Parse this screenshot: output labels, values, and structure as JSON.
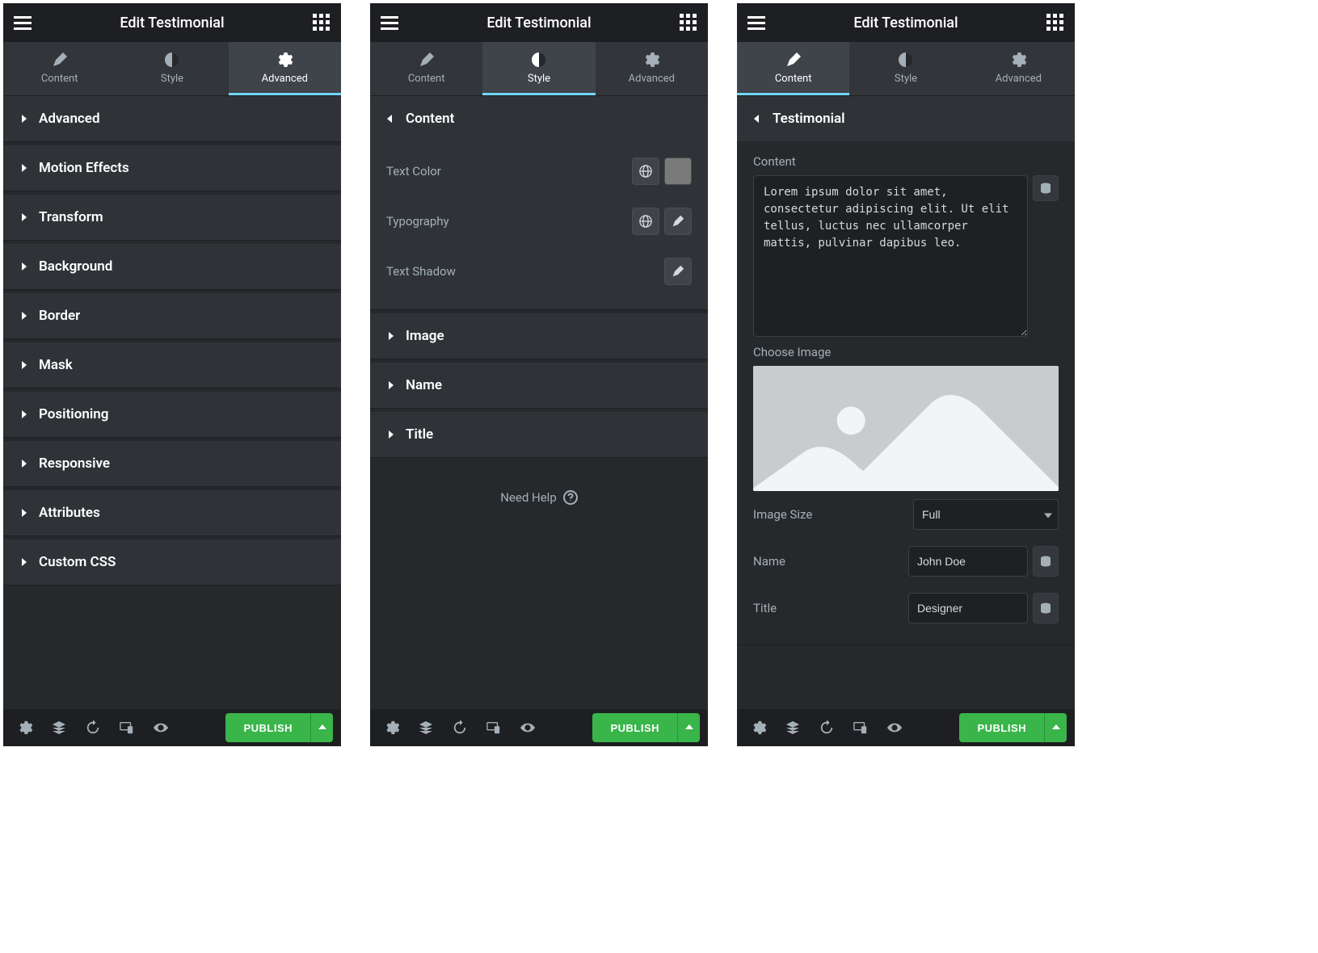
{
  "header": {
    "title": "Edit Testimonial"
  },
  "tabs": {
    "content": "Content",
    "style": "Style",
    "advanced": "Advanced"
  },
  "footer": {
    "publish": "PUBLISH"
  },
  "panel_advanced": {
    "sections": [
      "Advanced",
      "Motion Effects",
      "Transform",
      "Background",
      "Border",
      "Mask",
      "Positioning",
      "Responsive",
      "Attributes",
      "Custom CSS"
    ]
  },
  "panel_style": {
    "section_content": "Content",
    "text_color_label": "Text Color",
    "text_color_value": "#7a7a7a",
    "typography_label": "Typography",
    "text_shadow_label": "Text Shadow",
    "section_image": "Image",
    "section_name": "Name",
    "section_title": "Title",
    "help": "Need Help"
  },
  "panel_content": {
    "section_testimonial": "Testimonial",
    "content_label": "Content",
    "content_value": "Lorem ipsum dolor sit amet, consectetur adipiscing elit. Ut elit tellus, luctus nec ullamcorper mattis, pulvinar dapibus leo.",
    "choose_image_label": "Choose Image",
    "image_size_label": "Image Size",
    "image_size_value": "Full",
    "name_label": "Name",
    "name_value": "John Doe",
    "title_label": "Title",
    "title_value": "Designer"
  }
}
